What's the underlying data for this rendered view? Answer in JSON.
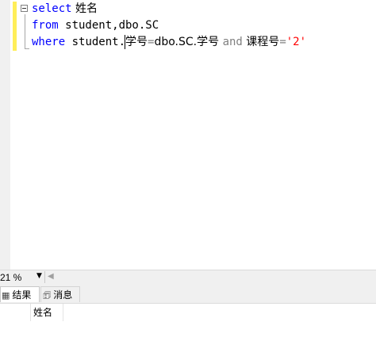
{
  "editor": {
    "line1": {
      "keyword": "select",
      "rest": " 姓名"
    },
    "line2": {
      "keyword": "from",
      "rest": " student,dbo.SC"
    },
    "line3": {
      "keyword": "where",
      "part1": " student.",
      "part2": "学号",
      "op_eq": "=",
      "part3": "dbo.SC.学号 ",
      "and_kw": "and",
      "part4": " 课程号",
      "op_eq2": "=",
      "string_val": "'2'"
    }
  },
  "status": {
    "zoom": "21 %"
  },
  "tabs": {
    "results_icon": "grid-icon",
    "results_label": "结果",
    "messages_icon": "message-icon",
    "messages_label": "消息"
  },
  "results": {
    "columns": [
      "姓名"
    ]
  },
  "colors": {
    "keyword": "#0000ff",
    "string": "#ff0000",
    "operator": "#808080",
    "change_bar": "#ffee58"
  }
}
